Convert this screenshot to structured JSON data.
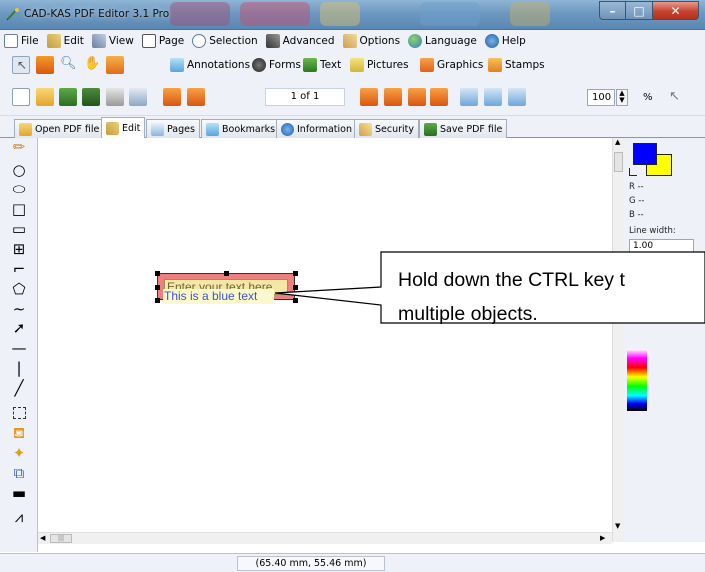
{
  "window": {
    "title": "CAD-KAS PDF Editor 3.1 Pro"
  },
  "menu": [
    {
      "label": "File",
      "icon": "file-icon"
    },
    {
      "label": "Edit",
      "icon": "edit-icon"
    },
    {
      "label": "View",
      "icon": "view-icon"
    },
    {
      "label": "Page",
      "icon": "page-icon"
    },
    {
      "label": "Selection",
      "icon": "selection-icon"
    },
    {
      "label": "Advanced",
      "icon": "advanced-icon"
    },
    {
      "label": "Options",
      "icon": "options-icon"
    },
    {
      "label": "Language",
      "icon": "language-icon"
    },
    {
      "label": "Help",
      "icon": "help-icon"
    }
  ],
  "toolbar": {
    "annotations_label": "Annotations",
    "forms_label": "Forms",
    "text_label": "Text",
    "pictures_label": "Pictures",
    "graphics_label": "Graphics",
    "stamps_label": "Stamps",
    "page_indicator": "1 of 1",
    "zoom_value": "100",
    "zoom_unit": "%"
  },
  "tabs": [
    {
      "label": "Open PDF file"
    },
    {
      "label": "Edit"
    },
    {
      "label": "Pages"
    },
    {
      "label": "Bookmarks"
    },
    {
      "label": "Information"
    },
    {
      "label": "Security"
    },
    {
      "label": "Save PDF file"
    }
  ],
  "canvas": {
    "selected_field_text": "Enter your text here",
    "blue_text": "This is a blue text",
    "callout_line1": "Hold down the CTRL key t",
    "callout_line2": "multiple objects."
  },
  "right_panel": {
    "r_label": "R --",
    "g_label": "G --",
    "b_label": "B --",
    "line_width_label": "Line width:",
    "line_width_value": "1.00",
    "foreground_color": "#0000ff",
    "background_color": "#ffff00"
  },
  "status": {
    "coords": "(65.40 mm, 55.46 mm)"
  },
  "scroll": {
    "h_grip": "|||"
  }
}
